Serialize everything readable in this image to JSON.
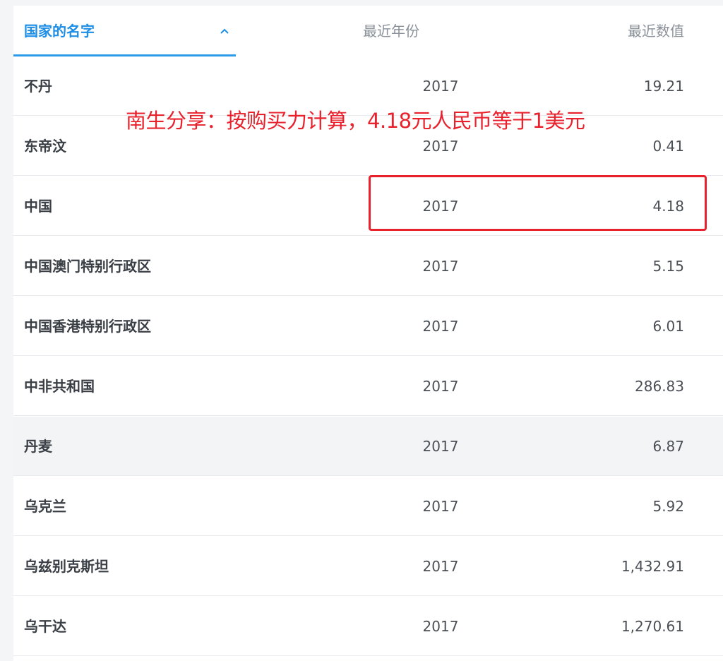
{
  "table": {
    "columns": {
      "name": "国家的名字",
      "year": "最近年份",
      "value": "最近数值"
    },
    "sort_icon": "chevron-up-icon",
    "rows": [
      {
        "name": "不丹",
        "year": "2017",
        "value": "19.21"
      },
      {
        "name": "东帝汶",
        "year": "2017",
        "value": "0.41"
      },
      {
        "name": "中国",
        "year": "2017",
        "value": "4.18"
      },
      {
        "name": "中国澳门特别行政区",
        "year": "2017",
        "value": "5.15"
      },
      {
        "name": "中国香港特别行政区",
        "year": "2017",
        "value": "6.01"
      },
      {
        "name": "中非共和国",
        "year": "2017",
        "value": "286.83"
      },
      {
        "name": "丹麦",
        "year": "2017",
        "value": "6.87"
      },
      {
        "name": "乌克兰",
        "year": "2017",
        "value": "5.92"
      },
      {
        "name": "乌兹别克斯坦",
        "year": "2017",
        "value": "1,432.91"
      },
      {
        "name": "乌干达",
        "year": "2017",
        "value": "1,270.61"
      }
    ]
  },
  "annotation": {
    "text": "南生分享：按购买力计算，4.18元人民币等于1美元",
    "color": "#e8212c"
  },
  "colors": {
    "accent": "#1e8ee6",
    "highlight": "#e8212c"
  }
}
